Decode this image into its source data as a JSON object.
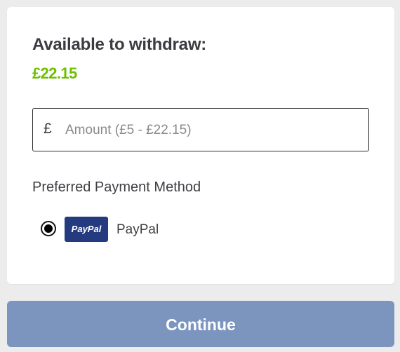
{
  "withdraw": {
    "available_label": "Available to withdraw:",
    "balance": "£22.15",
    "currency_symbol": "£",
    "amount_placeholder": "Amount (£5 - £22.15)",
    "amount_value": "",
    "payment_method_label": "Preferred Payment Method",
    "methods": [
      {
        "logo_text": "PayPal",
        "label": "PayPal",
        "selected": true,
        "icon": "paypal-logo"
      }
    ],
    "continue_label": "Continue"
  },
  "colors": {
    "balance_green": "#6cc000",
    "paypal_blue": "#253b80",
    "button_blue": "#7c95bf",
    "background": "#ececec"
  }
}
